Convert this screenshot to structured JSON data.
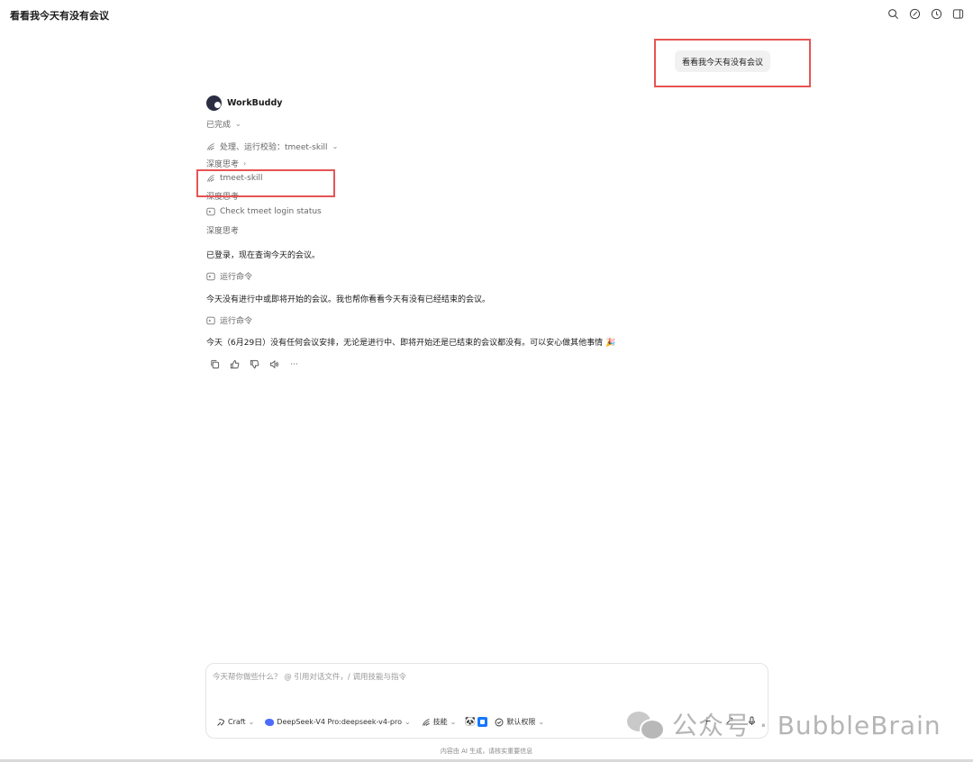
{
  "window": {
    "title": "看看我今天有没有会议",
    "icons": [
      "search-icon",
      "new-chat-icon",
      "history-icon",
      "sidebar-toggle-icon"
    ]
  },
  "user_message": "看看我今天有没有会议",
  "assistant": {
    "name": "WorkBuddy",
    "status": "已完成",
    "steps": [
      {
        "icon": "skill-icon",
        "text": "处理、运行校验：tmeet-skill"
      },
      {
        "icon": "",
        "text": "深度思考"
      },
      {
        "icon": "skill-icon",
        "text": "tmeet-skill"
      },
      {
        "icon": "",
        "text": "深度思考"
      },
      {
        "icon": "terminal-icon",
        "text": "Check tmeet login status"
      },
      {
        "icon": "",
        "text": "深度思考"
      }
    ],
    "messages": [
      "已登录，现在查询今天的会议。",
      "今天没有进行中或即将开始的会议。我也帮你看看今天有没有已经结束的会议。",
      "今天（6月29日）没有任何会议安排，无论是进行中、即将开始还是已结束的会议都没有。可以安心做其他事情 🎉"
    ],
    "run_command_label": "运行命令",
    "actions": [
      "copy-icon",
      "thumbs-up-icon",
      "thumbs-down-icon",
      "speaker-icon",
      "more-icon"
    ],
    "more_label": "···"
  },
  "composer": {
    "placeholder": "今天帮你做些什么？ @ 引用对话文件，/ 调用技能与指令",
    "mode": "Craft",
    "model": "DeepSeek-V4 Pro:deepseek-v4-pro",
    "skills": "技能",
    "permission": "默认权限"
  },
  "footnote": "内容由 AI 生成，请核实重要信息",
  "watermark": {
    "text": "公众号 · BubbleBrain"
  },
  "colors": {
    "highlight_box": "#e65454",
    "bubble_bg": "#f1f1f2",
    "model_accent": "#4d6bfe"
  }
}
